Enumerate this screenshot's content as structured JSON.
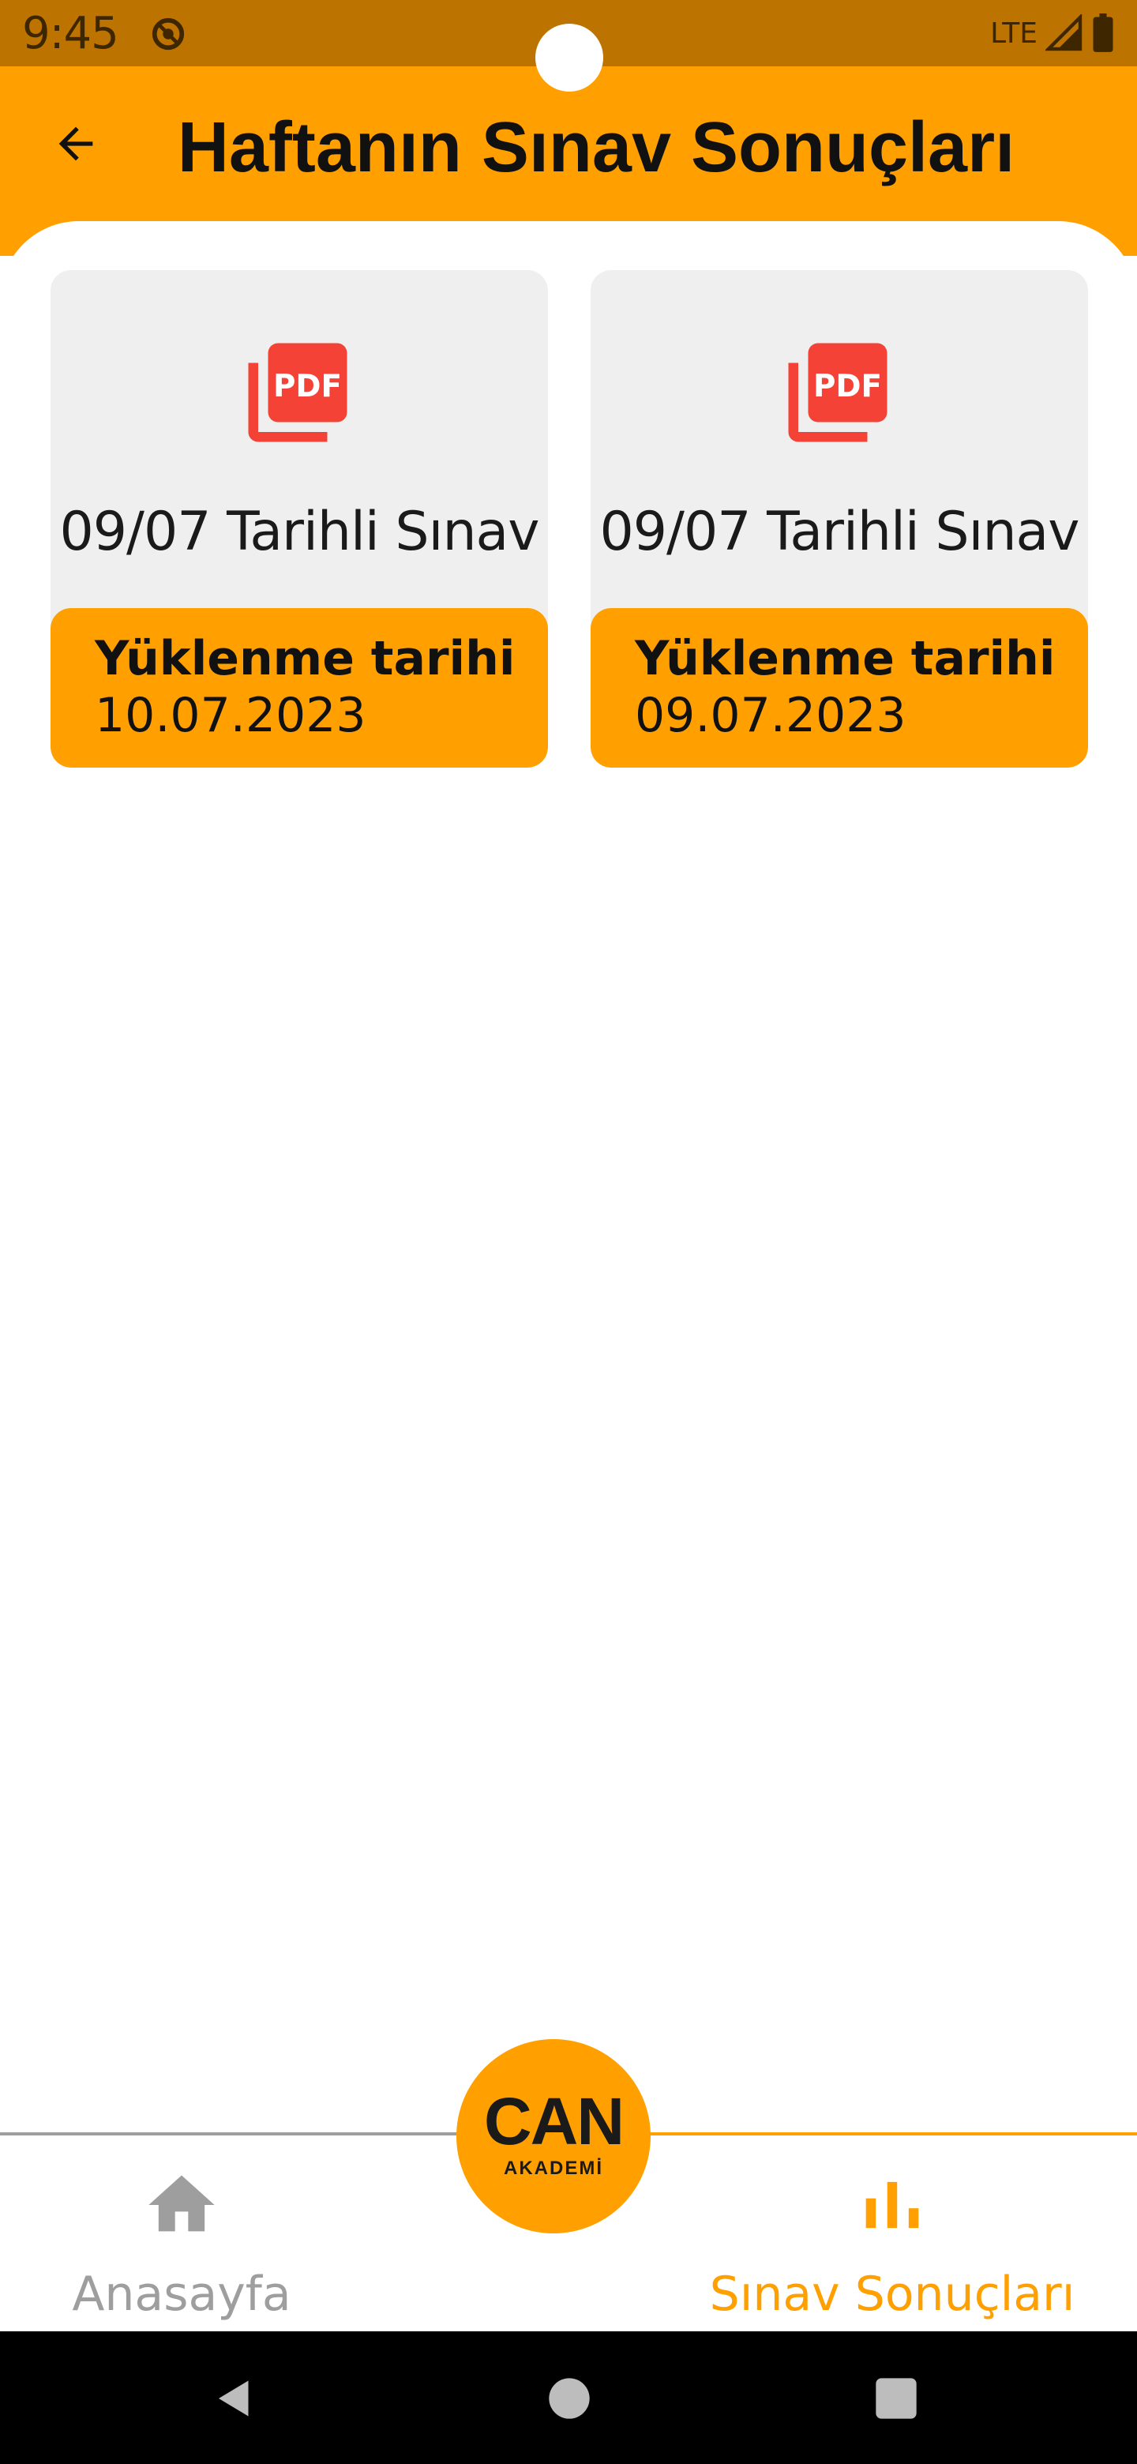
{
  "status_bar": {
    "time": "9:45",
    "network": "LTE",
    "icons": [
      "do-not-disturb-icon",
      "signal-icon",
      "battery-icon"
    ]
  },
  "header": {
    "title": "Haftanın Sınav Sonuçları",
    "back_icon": "arrow-left-icon"
  },
  "cards": [
    {
      "title": "09/07 Tarihli Sınav",
      "upload_label": "Yüklenme tarihi",
      "upload_date": "10.07.2023",
      "icon": "pdf-icon"
    },
    {
      "title": "09/07 Tarihli Sınav",
      "upload_label": "Yüklenme tarihi",
      "upload_date": "09.07.2023",
      "icon": "pdf-icon"
    }
  ],
  "bottom_nav": {
    "items": [
      {
        "label": "Anasayfa",
        "icon": "home-icon",
        "active": false
      },
      {
        "label": "Sınav Sonuçları",
        "icon": "bar-chart-icon",
        "active": true
      }
    ],
    "center_logo": {
      "main": "CAN",
      "sub": "AKADEMİ"
    }
  },
  "colors": {
    "accent": "#ffa000",
    "status_bar": "#bd7300",
    "card_bg": "#efefef",
    "pdf_red": "#f44336",
    "inactive": "#9e9e9e"
  }
}
